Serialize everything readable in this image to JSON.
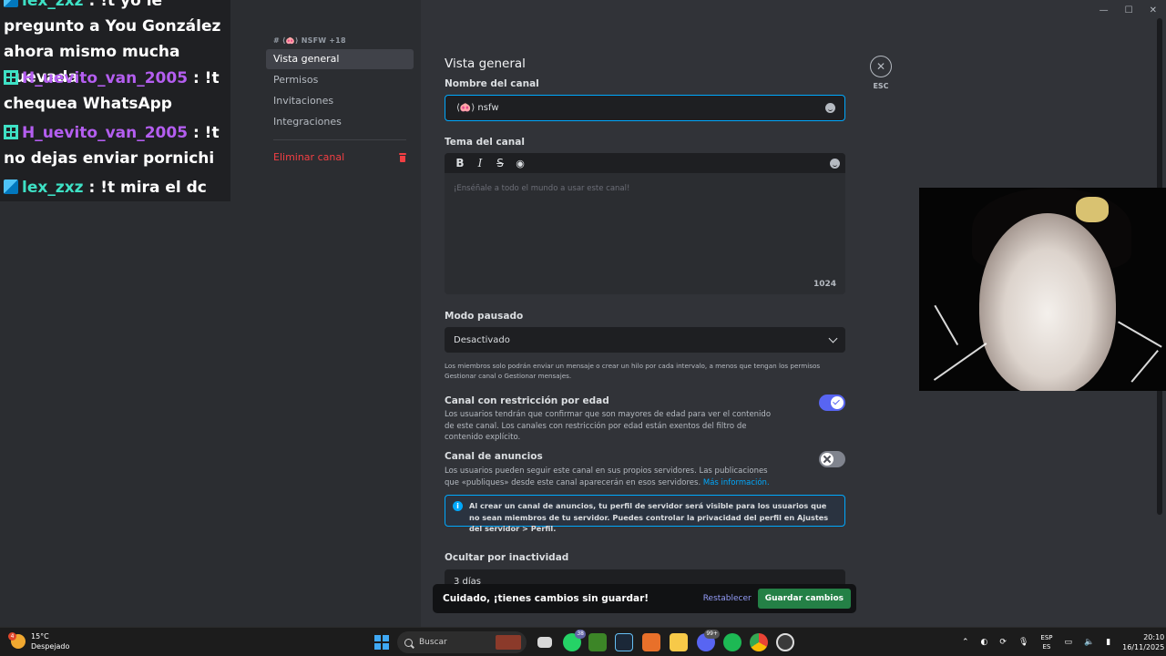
{
  "chat": {
    "messages": [
      {
        "user": "lex_zxz",
        "text": ": !t yo le pregunto a You González ahora mismo mucha huevada"
      },
      {
        "user": "H_uevito_van_2005",
        "text": ": !t chequea WhatsApp"
      },
      {
        "user": "H_uevito_van_2005",
        "text": ": !t no dejas enviar pornichi"
      },
      {
        "user": "lex_zxz",
        "text": ": !t mira el dc"
      }
    ]
  },
  "nav": {
    "header": "# ⟨🐽⟩ NSFW +18",
    "items": [
      "Vista general",
      "Permisos",
      "Invitaciones",
      "Integraciones"
    ],
    "delete": "Eliminar canal"
  },
  "main": {
    "title": "Vista general",
    "name_label": "Nombre del canal",
    "name_value": "⟨🐽⟩ nsfw",
    "topic_label": "Tema del canal",
    "topic_placeholder": "¡Enséñale a todo el mundo a usar este canal!",
    "topic_count": "1024",
    "slowmode_label": "Modo pausado",
    "slowmode_value": "Desactivado",
    "slowmode_desc": "Los miembros solo podrán enviar un mensaje o crear un hilo por cada intervalo, a menos que tengan los permisos Gestionar canal o Gestionar mensajes.",
    "age_label": "Canal con restricción por edad",
    "age_desc": "Los usuarios tendrán que confirmar que son mayores de edad para ver el contenido de este canal. Los canales con restricción por edad están exentos del filtro de contenido explícito.",
    "announce_label": "Canal de anuncios",
    "announce_desc": "Los usuarios pueden seguir este canal en sus propios servidores. Las publicaciones que «publiques» desde este canal aparecerán en esos servidores.",
    "announce_link": "Más información.",
    "info_text": "Al crear un canal de anuncios, tu perfil de servidor será visible para los usuarios que no sean miembros de tu servidor. Puedes controlar la privacidad del perfil en Ajustes del servidor > Perfil.",
    "inactivity_label": "Ocultar por inactividad",
    "inactivity_value": "3 días",
    "esc": "ESC",
    "toggles": {
      "age_restricted": true,
      "announcement": false
    }
  },
  "unsaved": {
    "text": "Cuidado, ¡tienes cambios sin guardar!",
    "reset": "Restablecer",
    "save": "Guardar cambios"
  },
  "taskbar": {
    "weather_temp": "15°C",
    "weather_desc": "Despejado",
    "weather_badge": "4",
    "search": "Buscar",
    "whatsapp_badge": "38",
    "discord_badge": "99+",
    "lang1": "ESP",
    "lang2": "ES",
    "time": "20:10",
    "date": "16/11/2025"
  },
  "colors": {
    "accent": "#5865f2",
    "danger": "#f23f43",
    "link": "#00a8fc",
    "save": "#248046"
  }
}
